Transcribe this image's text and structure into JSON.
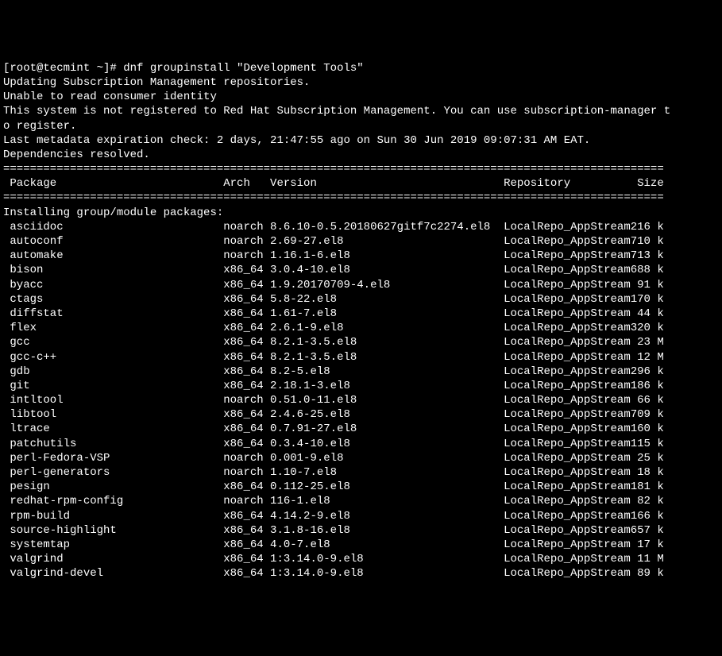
{
  "prompt": "[root@tecmint ~]# ",
  "command": "dnf groupinstall \"Development Tools\"",
  "preamble": [
    "Updating Subscription Management repositories.",
    "Unable to read consumer identity",
    "This system is not registered to Red Hat Subscription Management. You can use subscription-manager t",
    "o register.",
    "Last metadata expiration check: 2 days, 21:47:55 ago on Sun 30 Jun 2019 09:07:31 AM EAT.",
    "Dependencies resolved."
  ],
  "divider": "===================================================================================================",
  "headers": {
    "package": "Package",
    "arch": "Arch",
    "version": "Version",
    "repository": "Repository",
    "size": "Size"
  },
  "section_title": "Installing group/module packages:",
  "packages": [
    {
      "name": "asciidoc",
      "arch": "noarch",
      "version": "8.6.10-0.5.20180627gitf7c2274.el8",
      "repo": "LocalRepo_AppStream",
      "size": "216 k"
    },
    {
      "name": "autoconf",
      "arch": "noarch",
      "version": "2.69-27.el8",
      "repo": "LocalRepo_AppStream",
      "size": "710 k"
    },
    {
      "name": "automake",
      "arch": "noarch",
      "version": "1.16.1-6.el8",
      "repo": "LocalRepo_AppStream",
      "size": "713 k"
    },
    {
      "name": "bison",
      "arch": "x86_64",
      "version": "3.0.4-10.el8",
      "repo": "LocalRepo_AppStream",
      "size": "688 k"
    },
    {
      "name": "byacc",
      "arch": "x86_64",
      "version": "1.9.20170709-4.el8",
      "repo": "LocalRepo_AppStream",
      "size": " 91 k"
    },
    {
      "name": "ctags",
      "arch": "x86_64",
      "version": "5.8-22.el8",
      "repo": "LocalRepo_AppStream",
      "size": "170 k"
    },
    {
      "name": "diffstat",
      "arch": "x86_64",
      "version": "1.61-7.el8",
      "repo": "LocalRepo_AppStream",
      "size": " 44 k"
    },
    {
      "name": "flex",
      "arch": "x86_64",
      "version": "2.6.1-9.el8",
      "repo": "LocalRepo_AppStream",
      "size": "320 k"
    },
    {
      "name": "gcc",
      "arch": "x86_64",
      "version": "8.2.1-3.5.el8",
      "repo": "LocalRepo_AppStream",
      "size": " 23 M"
    },
    {
      "name": "gcc-c++",
      "arch": "x86_64",
      "version": "8.2.1-3.5.el8",
      "repo": "LocalRepo_AppStream",
      "size": " 12 M"
    },
    {
      "name": "gdb",
      "arch": "x86_64",
      "version": "8.2-5.el8",
      "repo": "LocalRepo_AppStream",
      "size": "296 k"
    },
    {
      "name": "git",
      "arch": "x86_64",
      "version": "2.18.1-3.el8",
      "repo": "LocalRepo_AppStream",
      "size": "186 k"
    },
    {
      "name": "intltool",
      "arch": "noarch",
      "version": "0.51.0-11.el8",
      "repo": "LocalRepo_AppStream",
      "size": " 66 k"
    },
    {
      "name": "libtool",
      "arch": "x86_64",
      "version": "2.4.6-25.el8",
      "repo": "LocalRepo_AppStream",
      "size": "709 k"
    },
    {
      "name": "ltrace",
      "arch": "x86_64",
      "version": "0.7.91-27.el8",
      "repo": "LocalRepo_AppStream",
      "size": "160 k"
    },
    {
      "name": "patchutils",
      "arch": "x86_64",
      "version": "0.3.4-10.el8",
      "repo": "LocalRepo_AppStream",
      "size": "115 k"
    },
    {
      "name": "perl-Fedora-VSP",
      "arch": "noarch",
      "version": "0.001-9.el8",
      "repo": "LocalRepo_AppStream",
      "size": " 25 k"
    },
    {
      "name": "perl-generators",
      "arch": "noarch",
      "version": "1.10-7.el8",
      "repo": "LocalRepo_AppStream",
      "size": " 18 k"
    },
    {
      "name": "pesign",
      "arch": "x86_64",
      "version": "0.112-25.el8",
      "repo": "LocalRepo_AppStream",
      "size": "181 k"
    },
    {
      "name": "redhat-rpm-config",
      "arch": "noarch",
      "version": "116-1.el8",
      "repo": "LocalRepo_AppStream",
      "size": " 82 k"
    },
    {
      "name": "rpm-build",
      "arch": "x86_64",
      "version": "4.14.2-9.el8",
      "repo": "LocalRepo_AppStream",
      "size": "166 k"
    },
    {
      "name": "source-highlight",
      "arch": "x86_64",
      "version": "3.1.8-16.el8",
      "repo": "LocalRepo_AppStream",
      "size": "657 k"
    },
    {
      "name": "systemtap",
      "arch": "x86_64",
      "version": "4.0-7.el8",
      "repo": "LocalRepo_AppStream",
      "size": " 17 k"
    },
    {
      "name": "valgrind",
      "arch": "x86_64",
      "version": "1:3.14.0-9.el8",
      "repo": "LocalRepo_AppStream",
      "size": " 11 M"
    },
    {
      "name": "valgrind-devel",
      "arch": "x86_64",
      "version": "1:3.14.0-9.el8",
      "repo": "LocalRepo_AppStream",
      "size": " 89 k"
    }
  ]
}
